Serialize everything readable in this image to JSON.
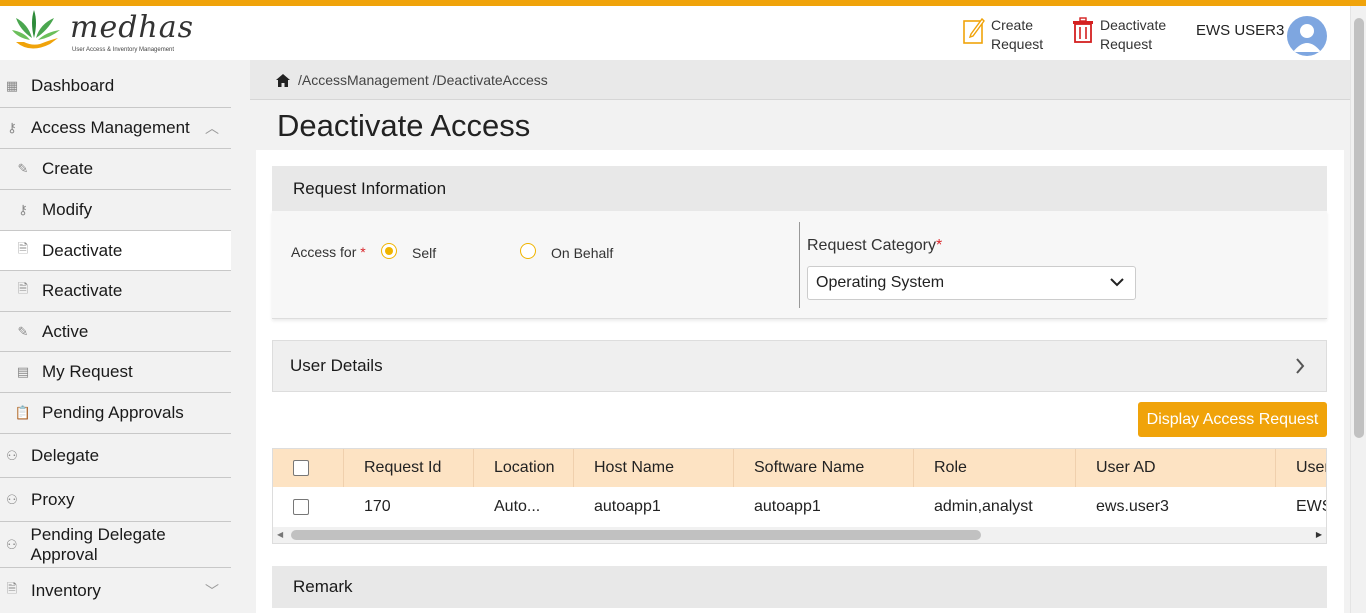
{
  "header": {
    "brand": "medhas",
    "tagline": "User Access & Inventory Management",
    "create_request": "Create Request",
    "deactivate_request": "Deactivate Request",
    "username": "EWS USER3"
  },
  "sidebar": {
    "items": [
      {
        "label": "Dashboard",
        "icon": "grid-icon"
      },
      {
        "label": "Access Management",
        "icon": "key-icon"
      },
      {
        "label": "Create",
        "icon": "edit-icon"
      },
      {
        "label": "Modify",
        "icon": "key-icon"
      },
      {
        "label": "Deactivate",
        "icon": "document-icon"
      },
      {
        "label": "Reactivate",
        "icon": "document-icon"
      },
      {
        "label": "Active",
        "icon": "edit-icon"
      },
      {
        "label": "My Request",
        "icon": "table-icon"
      },
      {
        "label": "Pending Approvals",
        "icon": "clipboard-icon"
      },
      {
        "label": "Delegate",
        "icon": "users-icon"
      },
      {
        "label": "Proxy",
        "icon": "users-icon"
      },
      {
        "label": "Pending Delegate Approval",
        "icon": "users-icon"
      },
      {
        "label": "Inventory",
        "icon": "document-icon"
      }
    ]
  },
  "breadcrumb": "/AccessManagement /DeactivateAccess",
  "page_title": "Deactivate Access",
  "request_info": {
    "title": "Request Information",
    "access_for_label": "Access for",
    "required_mark": "*",
    "option_self": "Self",
    "option_behalf": "On Behalf",
    "selected": "Self",
    "category_label": "Request Category",
    "category_value": "Operating System"
  },
  "user_details": {
    "title": "User Details"
  },
  "display_button": "Display Access Request",
  "table": {
    "columns": [
      "Request Id",
      "Location",
      "Host Name",
      "Software Name",
      "Role",
      "User AD",
      "User"
    ],
    "rows": [
      [
        "170",
        "Auto...",
        "autoapp1",
        "autoapp1",
        "admin,analyst",
        "ews.user3",
        "EWS"
      ]
    ]
  },
  "remark": {
    "title": "Remark"
  },
  "colors": {
    "accent": "#f0a30a",
    "table_header": "#fde3c3"
  }
}
